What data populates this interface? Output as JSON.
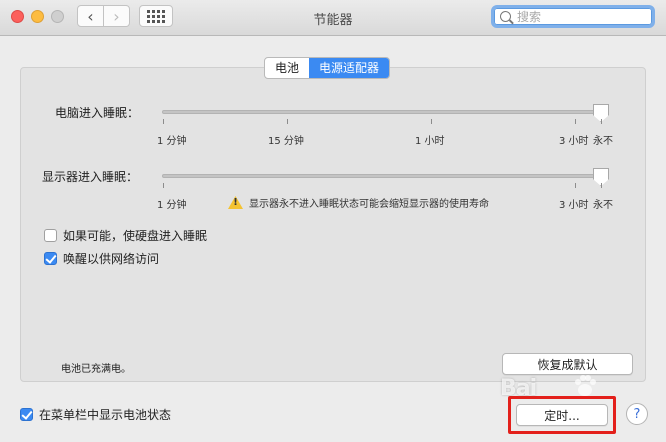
{
  "window": {
    "title": "节能器"
  },
  "toolbar": {
    "back": "‹",
    "forward": "›"
  },
  "search": {
    "placeholder": "搜索",
    "value": ""
  },
  "tabs": [
    {
      "label": "电池",
      "active": false
    },
    {
      "label": "电源适配器",
      "active": true
    }
  ],
  "computer_sleep": {
    "label": "电脑进入睡眠：",
    "scale": [
      "1 分钟",
      "15 分钟",
      "1 小时",
      "3 小时",
      "永不"
    ],
    "value": "永不"
  },
  "display_sleep": {
    "label": "显示器进入睡眠：",
    "scale": [
      "1 分钟",
      "3 小时",
      "永不"
    ],
    "value": "永不",
    "warning": "显示器永不进入睡眠状态可能会缩短显示器的使用寿命"
  },
  "options": [
    {
      "label": "如果可能，使硬盘进入睡眠",
      "checked": false
    },
    {
      "label": "唤醒以供网络访问",
      "checked": true
    }
  ],
  "status": "电池已充满电。",
  "restore_button": "恢复成默认",
  "menubar_option": {
    "label": "在菜单栏中显示电池状态",
    "checked": true
  },
  "schedule_button": "定时...",
  "help_button": "?",
  "watermark": "Bai",
  "colors": {
    "accent": "#3b8af2",
    "highlight": "#e3201b",
    "warning": "#f4c332"
  }
}
